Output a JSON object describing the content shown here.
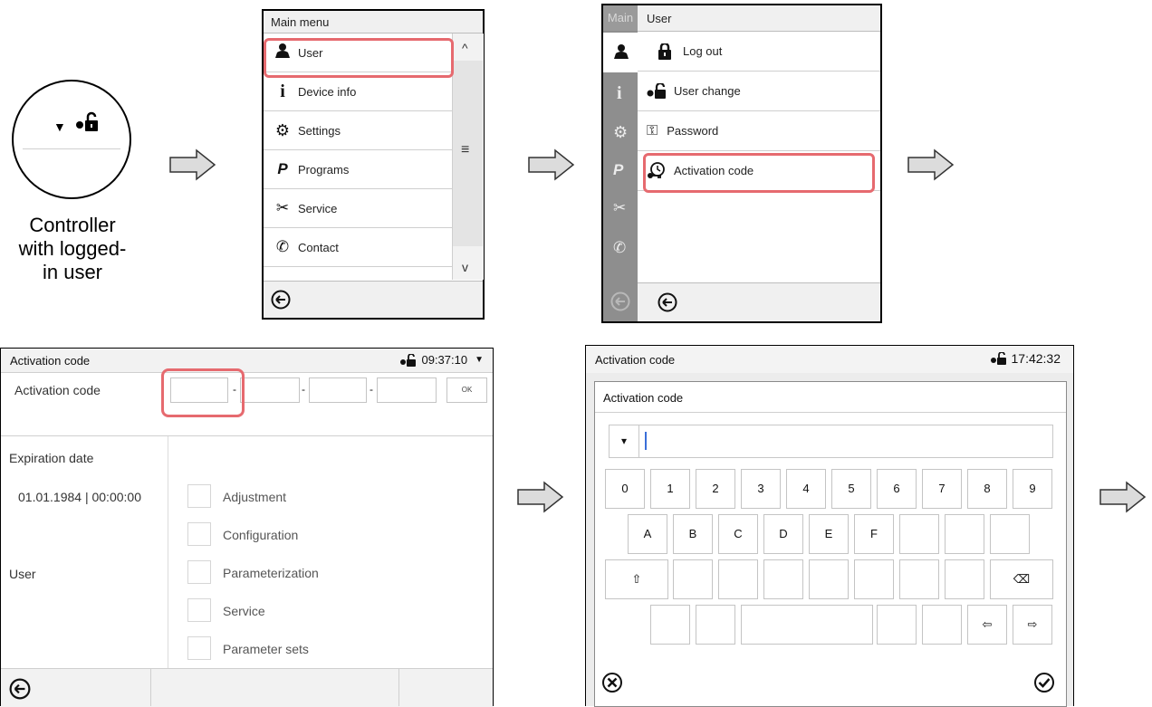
{
  "caption": {
    "line1": "Controller",
    "line2": "with logged-",
    "line3": "in user"
  },
  "main_menu": {
    "title": "Main menu",
    "items": [
      {
        "label": "User",
        "icon": "user-icon"
      },
      {
        "label": "Device info",
        "icon": "info-icon"
      },
      {
        "label": "Settings",
        "icon": "gears-icon"
      },
      {
        "label": "Programs",
        "icon": "programs-icon"
      },
      {
        "label": "Service",
        "icon": "tools-icon"
      },
      {
        "label": "Contact",
        "icon": "phone-icon"
      }
    ],
    "scroll_up": "^",
    "scroll_mid": "≡",
    "scroll_down": "v"
  },
  "user_menu": {
    "side_title": "Main",
    "title": "User",
    "items": [
      {
        "label": "Log out",
        "icon": "padlock-icon"
      },
      {
        "label": "User change",
        "icon": "user-change-icon"
      },
      {
        "label": "Password",
        "icon": "key-icon"
      },
      {
        "label": "Activation code",
        "icon": "activation-icon"
      }
    ]
  },
  "activation_screen": {
    "title": "Activation code",
    "time": "09:37:10",
    "code_label": "Activation code",
    "dash": "-",
    "ok": "OK",
    "expiration_label": "Expiration date",
    "expiration_value": "01.01.1984 | 00:00:00",
    "user_label": "User",
    "permissions": [
      "Adjustment",
      "Configuration",
      "Parameterization",
      "Service",
      "Parameter sets"
    ]
  },
  "keyboard_screen": {
    "title": "Activation code",
    "time": "17:42:32",
    "dialog_title": "Activation code",
    "dropdown": "▾",
    "row1": [
      "0",
      "1",
      "2",
      "3",
      "4",
      "5",
      "6",
      "7",
      "8",
      "9"
    ],
    "row2": [
      "A",
      "B",
      "C",
      "D",
      "E",
      "F",
      "",
      "",
      ""
    ],
    "shift": "⇧",
    "backspace": "⌫",
    "left": "⇦",
    "right": "⇨"
  },
  "colors": {
    "highlight": "#e66a6f",
    "caret": "#3a6fd8"
  }
}
